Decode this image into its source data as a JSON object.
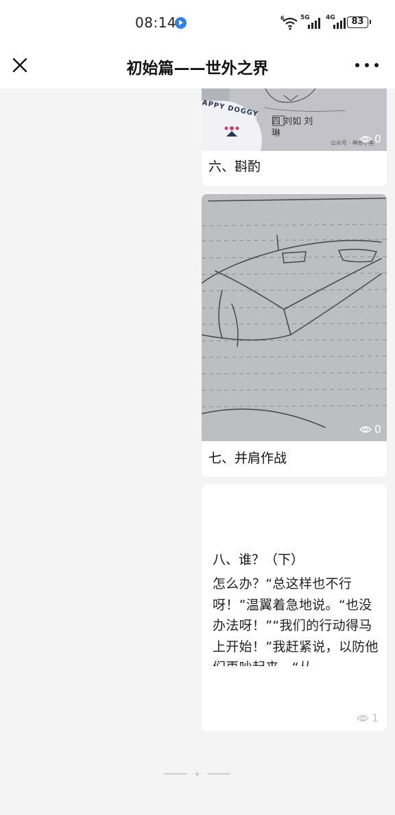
{
  "status_bar": {
    "time": "08:14",
    "network_5g_label": "5G",
    "network_4g_label": "4G",
    "battery_level": "83"
  },
  "nav": {
    "title": "初始篇——世外之界"
  },
  "cards": [
    {
      "title": "六、斟酌",
      "views": "0",
      "image_texts": {
        "sticker": "APPY DOGGY",
        "handwriting": "四 刘如 刘琳",
        "watermark": "公众号 · 神奇小鱼"
      }
    },
    {
      "title": "七、并肩作战",
      "views": "0"
    },
    {
      "title": "八、谁？（下）",
      "excerpt": "怎么办？“总这样也不行呀！”温翼着急地说。“也没办法呀！”“我们的行动得马上开始！”我赶紧说，以防他们再吵起来。“从…",
      "views": "1"
    }
  ],
  "pager": {
    "active_page": 1,
    "total_pages": 3
  }
}
